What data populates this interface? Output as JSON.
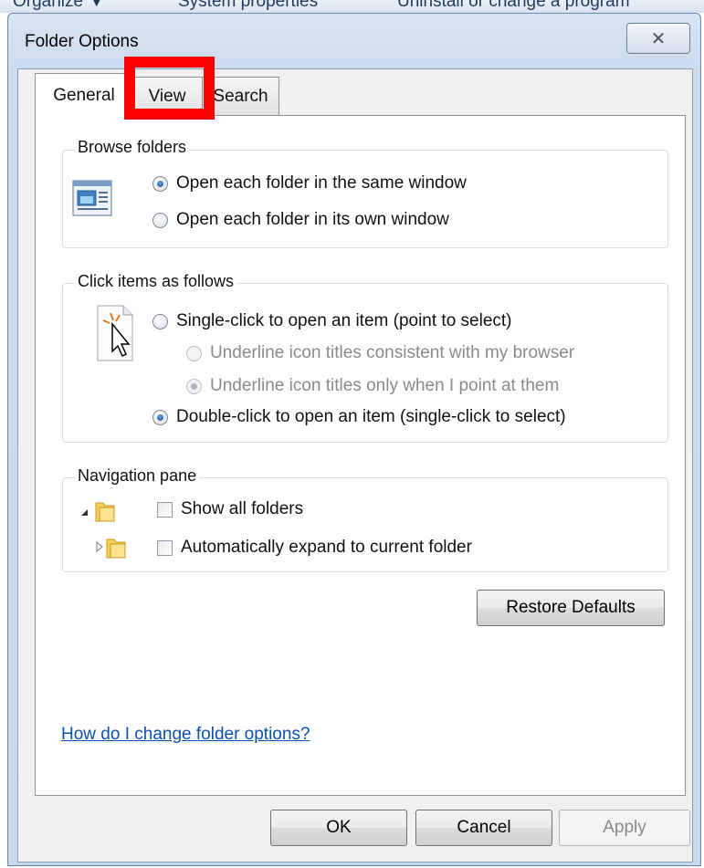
{
  "background_toolbar": {
    "items": [
      "Organize ▼",
      "System properties",
      "Uninstall or change a program"
    ]
  },
  "dialog": {
    "title": "Folder Options",
    "close_glyph": "✕"
  },
  "tabs": [
    {
      "label": "General",
      "active": true
    },
    {
      "label": "View",
      "active": false
    },
    {
      "label": "Search",
      "active": false
    }
  ],
  "browse_folders": {
    "legend": "Browse folders",
    "options": [
      {
        "label": "Open each folder in the same window",
        "checked": true
      },
      {
        "label": "Open each folder in its own window",
        "checked": false
      }
    ]
  },
  "click_items": {
    "legend": "Click items as follows",
    "single_click": "Single-click to open an item (point to select)",
    "underline_browser": "Underline icon titles consistent with my browser",
    "underline_point": "Underline icon titles only when I point at them",
    "double_click": "Double-click to open an item (single-click to select)"
  },
  "navigation_pane": {
    "legend": "Navigation pane",
    "show_all_folders": "Show all folders",
    "auto_expand": "Automatically expand to current folder"
  },
  "buttons": {
    "restore_defaults": "Restore Defaults",
    "ok": "OK",
    "cancel": "Cancel",
    "apply": "Apply"
  },
  "help_link": "How do I change folder options?",
  "icons": {
    "browse": "folder-window-icon",
    "click": "cursor-click-icon",
    "folder": "folder-icon"
  },
  "colors": {
    "highlight": "#ff0000",
    "link": "#0a50b0",
    "radio_selected": "#1c4f90"
  }
}
